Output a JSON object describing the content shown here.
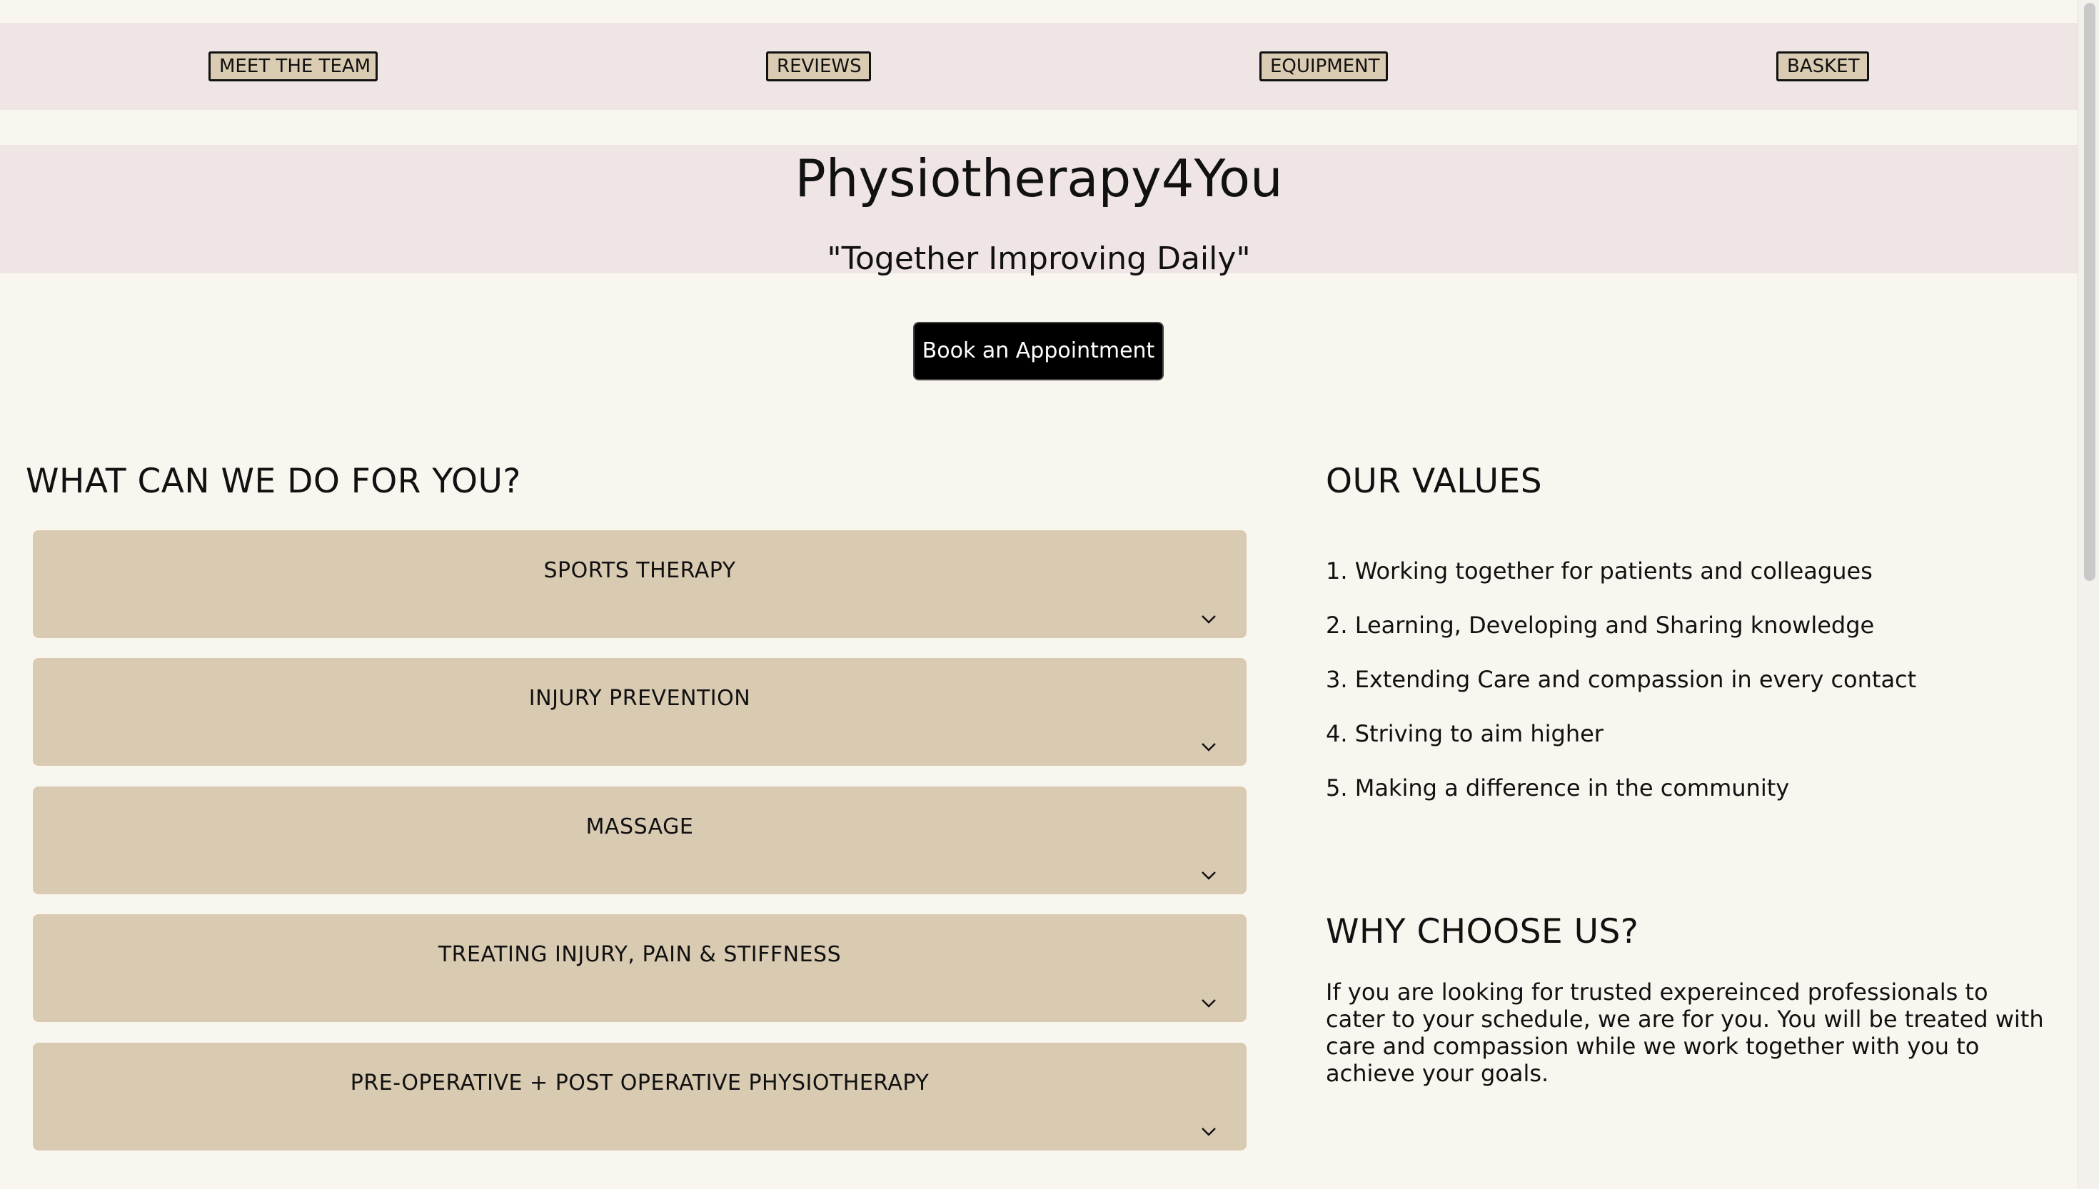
{
  "nav": {
    "items": [
      {
        "label": "MEET THE TEAM"
      },
      {
        "label": "REVIEWS"
      },
      {
        "label": "EQUIPMENT"
      },
      {
        "label": "BASKET"
      }
    ]
  },
  "hero": {
    "title": "Physiotherapy4You",
    "tagline": "\"Together Improving Daily\""
  },
  "cta": {
    "label": "Book an Appointment"
  },
  "services": {
    "heading": "WHAT CAN WE DO FOR YOU?",
    "items": [
      {
        "label": "SPORTS THERAPY"
      },
      {
        "label": "INJURY PREVENTION"
      },
      {
        "label": "MASSAGE"
      },
      {
        "label": "TREATING INJURY, PAIN & STIFFNESS"
      },
      {
        "label": "PRE-OPERATIVE + POST OPERATIVE PHYSIOTHERAPY"
      }
    ]
  },
  "values": {
    "heading": "OUR VALUES",
    "items": [
      "1. Working together for patients and colleagues",
      "2. Learning, Developing and Sharing knowledge",
      "3. Extending Care and compassion in every contact",
      "4. Striving to aim higher",
      "5. Making a difference in the community"
    ]
  },
  "why": {
    "heading": "WHY CHOOSE US?",
    "text": "If you are looking for trusted expereinced professionals to cater to your schedule, we are for you. You will be treated with care and compassion while we work together with you to achieve your goals."
  },
  "icons": {
    "accordion": "chevron-down-icon"
  },
  "colors": {
    "background": "#f9f5ef",
    "band": "#eee5e4",
    "accordion": "#d9cab2",
    "nav_button": "#dacbb3",
    "cta": "#000000"
  }
}
